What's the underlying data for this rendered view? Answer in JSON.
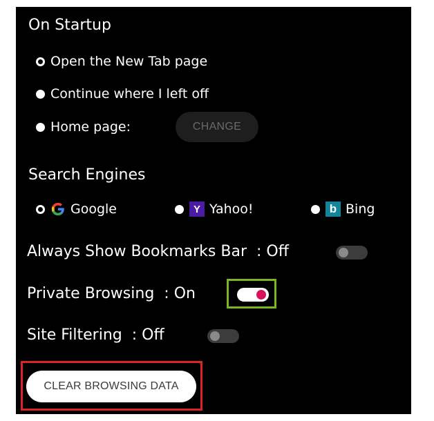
{
  "startup": {
    "title": "On Startup",
    "options": [
      {
        "label": "Open the New Tab page",
        "selected": true
      },
      {
        "label": "Continue where I left off",
        "selected": false
      },
      {
        "label": "Home page:",
        "selected": false
      }
    ],
    "change_label": "CHANGE"
  },
  "search_engines": {
    "title": "Search Engines",
    "options": [
      {
        "label": "Google",
        "icon": "google-icon",
        "selected": true
      },
      {
        "label": "Yahoo!",
        "icon": "yahoo-icon",
        "selected": false
      },
      {
        "label": "Bing",
        "icon": "bing-icon",
        "selected": false
      }
    ],
    "yahoo_glyph": "Y",
    "bing_glyph": "b"
  },
  "settings": {
    "bookmarks_bar": {
      "label": "Always Show Bookmarks Bar",
      "state": ": Off",
      "on": false
    },
    "private_browsing": {
      "label": "Private Browsing",
      "state": ": On",
      "on": true
    },
    "site_filtering": {
      "label": "Site Filtering",
      "state": ": Off",
      "on": false
    }
  },
  "clear_browsing_label": "CLEAR BROWSING DATA",
  "colors": {
    "accent_toggle_knob": "#d9115a",
    "highlight_green": "#7cb51e",
    "highlight_red": "#d9252a"
  }
}
